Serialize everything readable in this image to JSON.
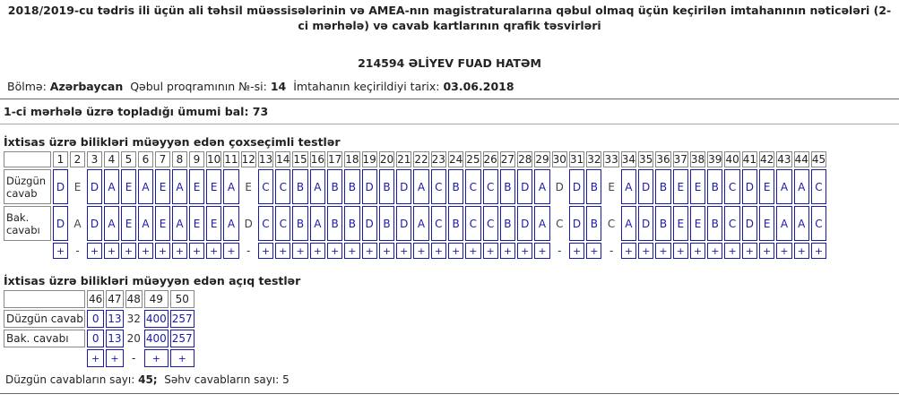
{
  "header": {
    "title": "2018/2019-cu tədris ili üçün ali təhsil müəssisələrinin və AMEA-nın magistraturalarına qəbul olmaq üçün keçirilən imtahanının nəticələri (2-ci mərhələ) və cavab kartlarının qrafik təsvirləri",
    "candidate": "214594  ƏLİYEV FUAD HATƏM"
  },
  "info": {
    "section_label": "Bölmə:",
    "section_value": "Azərbaycan",
    "program_label": "Qəbul proqramının №-si:",
    "program_value": "14",
    "date_label": "İmtahanın keçirildiyi tarix:",
    "date_value": "03.06.2018"
  },
  "total": "1-ci mərhələ üzrə topladığı ümumi bal: 73",
  "closed": {
    "heading": "İxtisas üzrə bilikləri müəyyən edən çoxseçimli testlər",
    "row_correct": "Düzgün cavab",
    "row_answer": "Bak. cavabı",
    "numbers": [
      "1",
      "2",
      "3",
      "4",
      "5",
      "6",
      "7",
      "8",
      "9",
      "10",
      "11",
      "12",
      "13",
      "14",
      "15",
      "16",
      "17",
      "18",
      "19",
      "20",
      "21",
      "22",
      "23",
      "24",
      "25",
      "26",
      "27",
      "28",
      "29",
      "30",
      "31",
      "32",
      "33",
      "34",
      "35",
      "36",
      "37",
      "38",
      "39",
      "40",
      "41",
      "42",
      "43",
      "44",
      "45"
    ],
    "correct": [
      "D",
      "E",
      "D",
      "A",
      "E",
      "A",
      "E",
      "A",
      "E",
      "E",
      "A",
      "E",
      "C",
      "C",
      "B",
      "A",
      "B",
      "B",
      "D",
      "B",
      "D",
      "A",
      "C",
      "B",
      "C",
      "C",
      "B",
      "D",
      "A",
      "D",
      "D",
      "B",
      "E",
      "A",
      "D",
      "B",
      "E",
      "E",
      "B",
      "C",
      "D",
      "E",
      "A",
      "A",
      "C"
    ],
    "answers": [
      "D",
      "A",
      "D",
      "A",
      "E",
      "A",
      "E",
      "A",
      "E",
      "E",
      "A",
      "D",
      "C",
      "C",
      "B",
      "A",
      "B",
      "B",
      "D",
      "B",
      "D",
      "A",
      "C",
      "B",
      "C",
      "C",
      "B",
      "D",
      "A",
      "C",
      "D",
      "B",
      "C",
      "A",
      "D",
      "B",
      "E",
      "E",
      "B",
      "C",
      "D",
      "E",
      "A",
      "A",
      "C"
    ],
    "marks": [
      "+",
      "-",
      "+",
      "+",
      "+",
      "+",
      "+",
      "+",
      "+",
      "+",
      "+",
      "-",
      "+",
      "+",
      "+",
      "+",
      "+",
      "+",
      "+",
      "+",
      "+",
      "+",
      "+",
      "+",
      "+",
      "+",
      "+",
      "+",
      "+",
      "-",
      "+",
      "+",
      "-",
      "+",
      "+",
      "+",
      "+",
      "+",
      "+",
      "+",
      "+",
      "+",
      "+",
      "+",
      "+"
    ]
  },
  "open": {
    "heading": "İxtisas üzrə bilikləri müəyyən edən açıq testlər",
    "row_correct": "Düzgün cavab",
    "row_answer": "Bak. cavabı",
    "numbers": [
      "46",
      "47",
      "48",
      "49",
      "50"
    ],
    "correct": [
      "0",
      "13",
      "32",
      "400",
      "257"
    ],
    "answers": [
      "0",
      "13",
      "20",
      "400",
      "257"
    ],
    "marks": [
      "+",
      "+",
      "-",
      "+",
      "+"
    ]
  },
  "counts": {
    "correct_label": "Düzgün cavabların sayı:",
    "correct_value": "45;",
    "wrong_label": "Səhv cavabların sayı:",
    "wrong_value": "5"
  }
}
